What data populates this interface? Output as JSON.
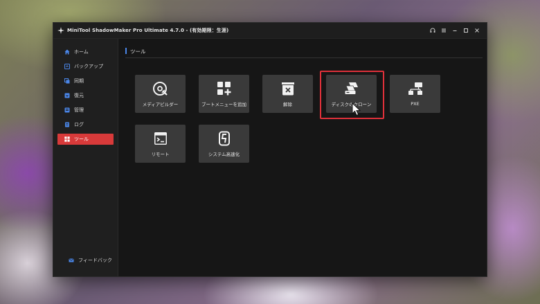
{
  "window": {
    "title": "MiniTool ShadowMaker Pro Ultimate 4.7.0 - (有効期限：生涯)",
    "controls": [
      "headset-icon",
      "menu-icon",
      "minimize-icon",
      "maximize-icon",
      "close-icon"
    ]
  },
  "sidebar": {
    "items": [
      {
        "label": "ホーム",
        "icon": "home-icon"
      },
      {
        "label": "バックアップ",
        "icon": "backup-icon"
      },
      {
        "label": "同期",
        "icon": "sync-icon"
      },
      {
        "label": "復元",
        "icon": "restore-icon"
      },
      {
        "label": "管理",
        "icon": "manage-icon"
      },
      {
        "label": "ログ",
        "icon": "log-icon"
      },
      {
        "label": "ツール",
        "icon": "tools-icon",
        "active": true
      }
    ],
    "feedback": {
      "label": "フィードバック",
      "icon": "mail-icon"
    }
  },
  "main": {
    "section_title": "ツール",
    "tools": [
      {
        "label": "メディアビルダー",
        "icon": "disc-icon"
      },
      {
        "label": "ブートメニューを追加",
        "icon": "add-grid-icon"
      },
      {
        "label": "解除",
        "icon": "unmount-icon"
      },
      {
        "label": "ディスクのクローン",
        "icon": "clone-disk-icon",
        "highlighted": true
      },
      {
        "label": "PXE",
        "icon": "network-icon"
      },
      {
        "label": "リモート",
        "icon": "terminal-icon"
      },
      {
        "label": "システム高速化",
        "icon": "speedup-icon"
      }
    ]
  },
  "colors": {
    "accent": "#d83a3a",
    "highlight_border": "#e0313a",
    "section_marker": "#4a86e8",
    "window_bg": "#161616",
    "tile_bg": "#3a3a3a"
  }
}
